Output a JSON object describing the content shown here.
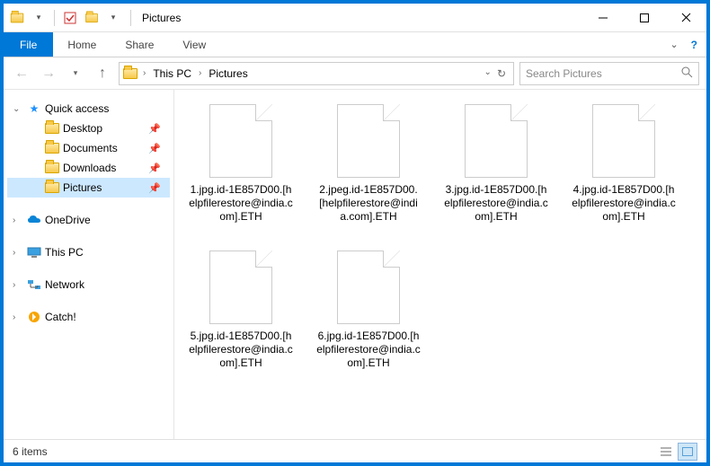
{
  "window": {
    "title": "Pictures"
  },
  "ribbon": {
    "file": "File",
    "tabs": [
      "Home",
      "Share",
      "View"
    ]
  },
  "breadcrumb": {
    "segments": [
      "This PC",
      "Pictures"
    ]
  },
  "search": {
    "placeholder": "Search Pictures"
  },
  "tree": {
    "quick_access": "Quick access",
    "items": [
      {
        "label": "Desktop",
        "pinned": true
      },
      {
        "label": "Documents",
        "pinned": true
      },
      {
        "label": "Downloads",
        "pinned": true
      },
      {
        "label": "Pictures",
        "pinned": true,
        "selected": true
      }
    ],
    "roots": [
      {
        "label": "OneDrive",
        "icon": "onedrive"
      },
      {
        "label": "This PC",
        "icon": "thispc"
      },
      {
        "label": "Network",
        "icon": "network"
      },
      {
        "label": "Catch!",
        "icon": "catch"
      }
    ]
  },
  "files": [
    {
      "name": "1.jpg.id-1E857D00.[helpfilerestore@india.com].ETH"
    },
    {
      "name": "2.jpeg.id-1E857D00.[helpfilerestore@india.com].ETH"
    },
    {
      "name": "3.jpg.id-1E857D00.[helpfilerestore@india.com].ETH"
    },
    {
      "name": "4.jpg.id-1E857D00.[helpfilerestore@india.com].ETH"
    },
    {
      "name": "5.jpg.id-1E857D00.[helpfilerestore@india.com].ETH"
    },
    {
      "name": "6.jpg.id-1E857D00.[helpfilerestore@india.com].ETH"
    }
  ],
  "status": {
    "text": "6 items"
  }
}
